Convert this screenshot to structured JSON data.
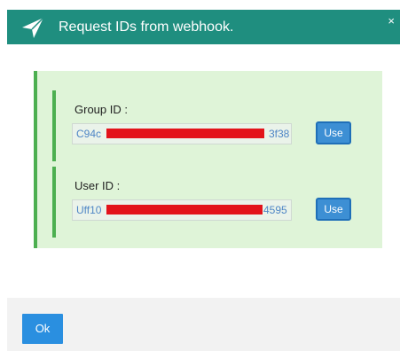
{
  "header": {
    "title": "Request IDs from webhook.",
    "close_label": "×",
    "icon": "paper-plane-icon",
    "background_color": "#1f8e7f"
  },
  "panel": {
    "background_color": "#dff4d8",
    "accent_color": "#4caf50"
  },
  "group": {
    "label": "Group ID :",
    "id_prefix": "C94c",
    "id_suffix": "3f38",
    "use_label": "Use"
  },
  "user": {
    "label": "User ID :",
    "id_prefix": "Uff10",
    "id_suffix": "4595",
    "use_label": "Use"
  },
  "footer": {
    "ok_label": "Ok"
  }
}
